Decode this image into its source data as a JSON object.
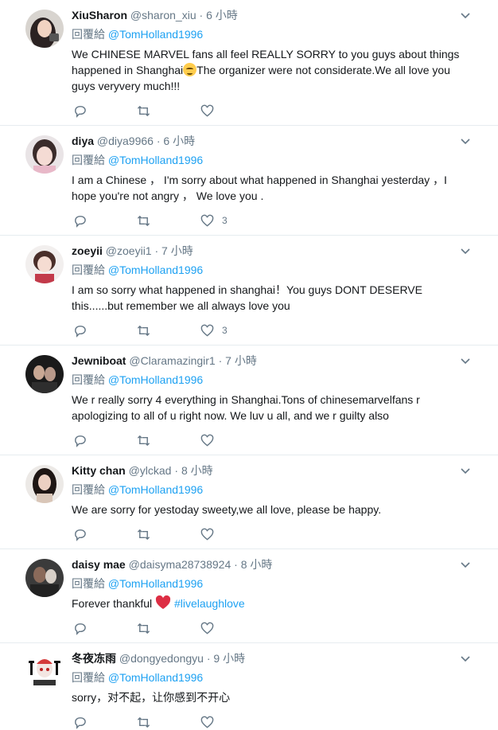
{
  "reply_prefix": "回覆給",
  "colors": {
    "accent": "#1da1f2",
    "muted": "#657786",
    "divider": "#e6ecf0",
    "heart": "#e0245e"
  },
  "tweets": [
    {
      "name": "XiuSharon",
      "handle": "@sharon_xiu",
      "dot": "·",
      "time": "6 小時",
      "reply_to": "@TomHolland1996",
      "text_before": "We CHINESE MARVEL fans all feel REALLY SORRY to you guys about things happened in Shanghai",
      "text_after": "The organizer were not considerate.We all love you guys veryvery much!!!",
      "emoji": "relieved-face",
      "likes": ""
    },
    {
      "name": "diya",
      "handle": "@diya9966",
      "dot": "·",
      "time": "6 小時",
      "reply_to": "@TomHolland1996",
      "text": "I am a Chinese ， I'm sorry about what happened in Shanghai yesterday ，I hope you're not angry ， We love you .",
      "likes": "3"
    },
    {
      "name": "zoeyii",
      "handle": "@zoeyii1",
      "dot": "·",
      "time": "7 小時",
      "reply_to": "@TomHolland1996",
      "text": "I am so sorry what happened in shanghai！You guys DONT DESERVE this......but remember we all always love you",
      "likes": "3"
    },
    {
      "name": "Jewniboat",
      "handle": "@Claramazingir1",
      "dot": "·",
      "time": "7 小時",
      "reply_to": "@TomHolland1996",
      "text": "We r really sorry 4 everything in Shanghai.Tons of chinesemarvelfans r apologizing to all of u right now. We luv u all, and we r guilty also",
      "likes": ""
    },
    {
      "name": "Kitty chan",
      "handle": "@ylckad",
      "dot": "·",
      "time": "8 小時",
      "reply_to": "@TomHolland1996",
      "text": "We are sorry  for yestoday sweety,we all love, please be happy.",
      "likes": ""
    },
    {
      "name": "daisy mae",
      "handle": "@daisyma28738924",
      "dot": "·",
      "time": "8 小時",
      "reply_to": "@TomHolland1996",
      "text_before": "Forever thankful ",
      "emoji": "red-heart",
      "hashtag": "#livelaughlove",
      "likes": ""
    },
    {
      "name": "冬夜冻雨",
      "handle": "@dongyedongyu",
      "dot": "·",
      "time": "9 小時",
      "reply_to": "@TomHolland1996",
      "text": "sorry，对不起，让你感到不开心",
      "likes": ""
    }
  ]
}
